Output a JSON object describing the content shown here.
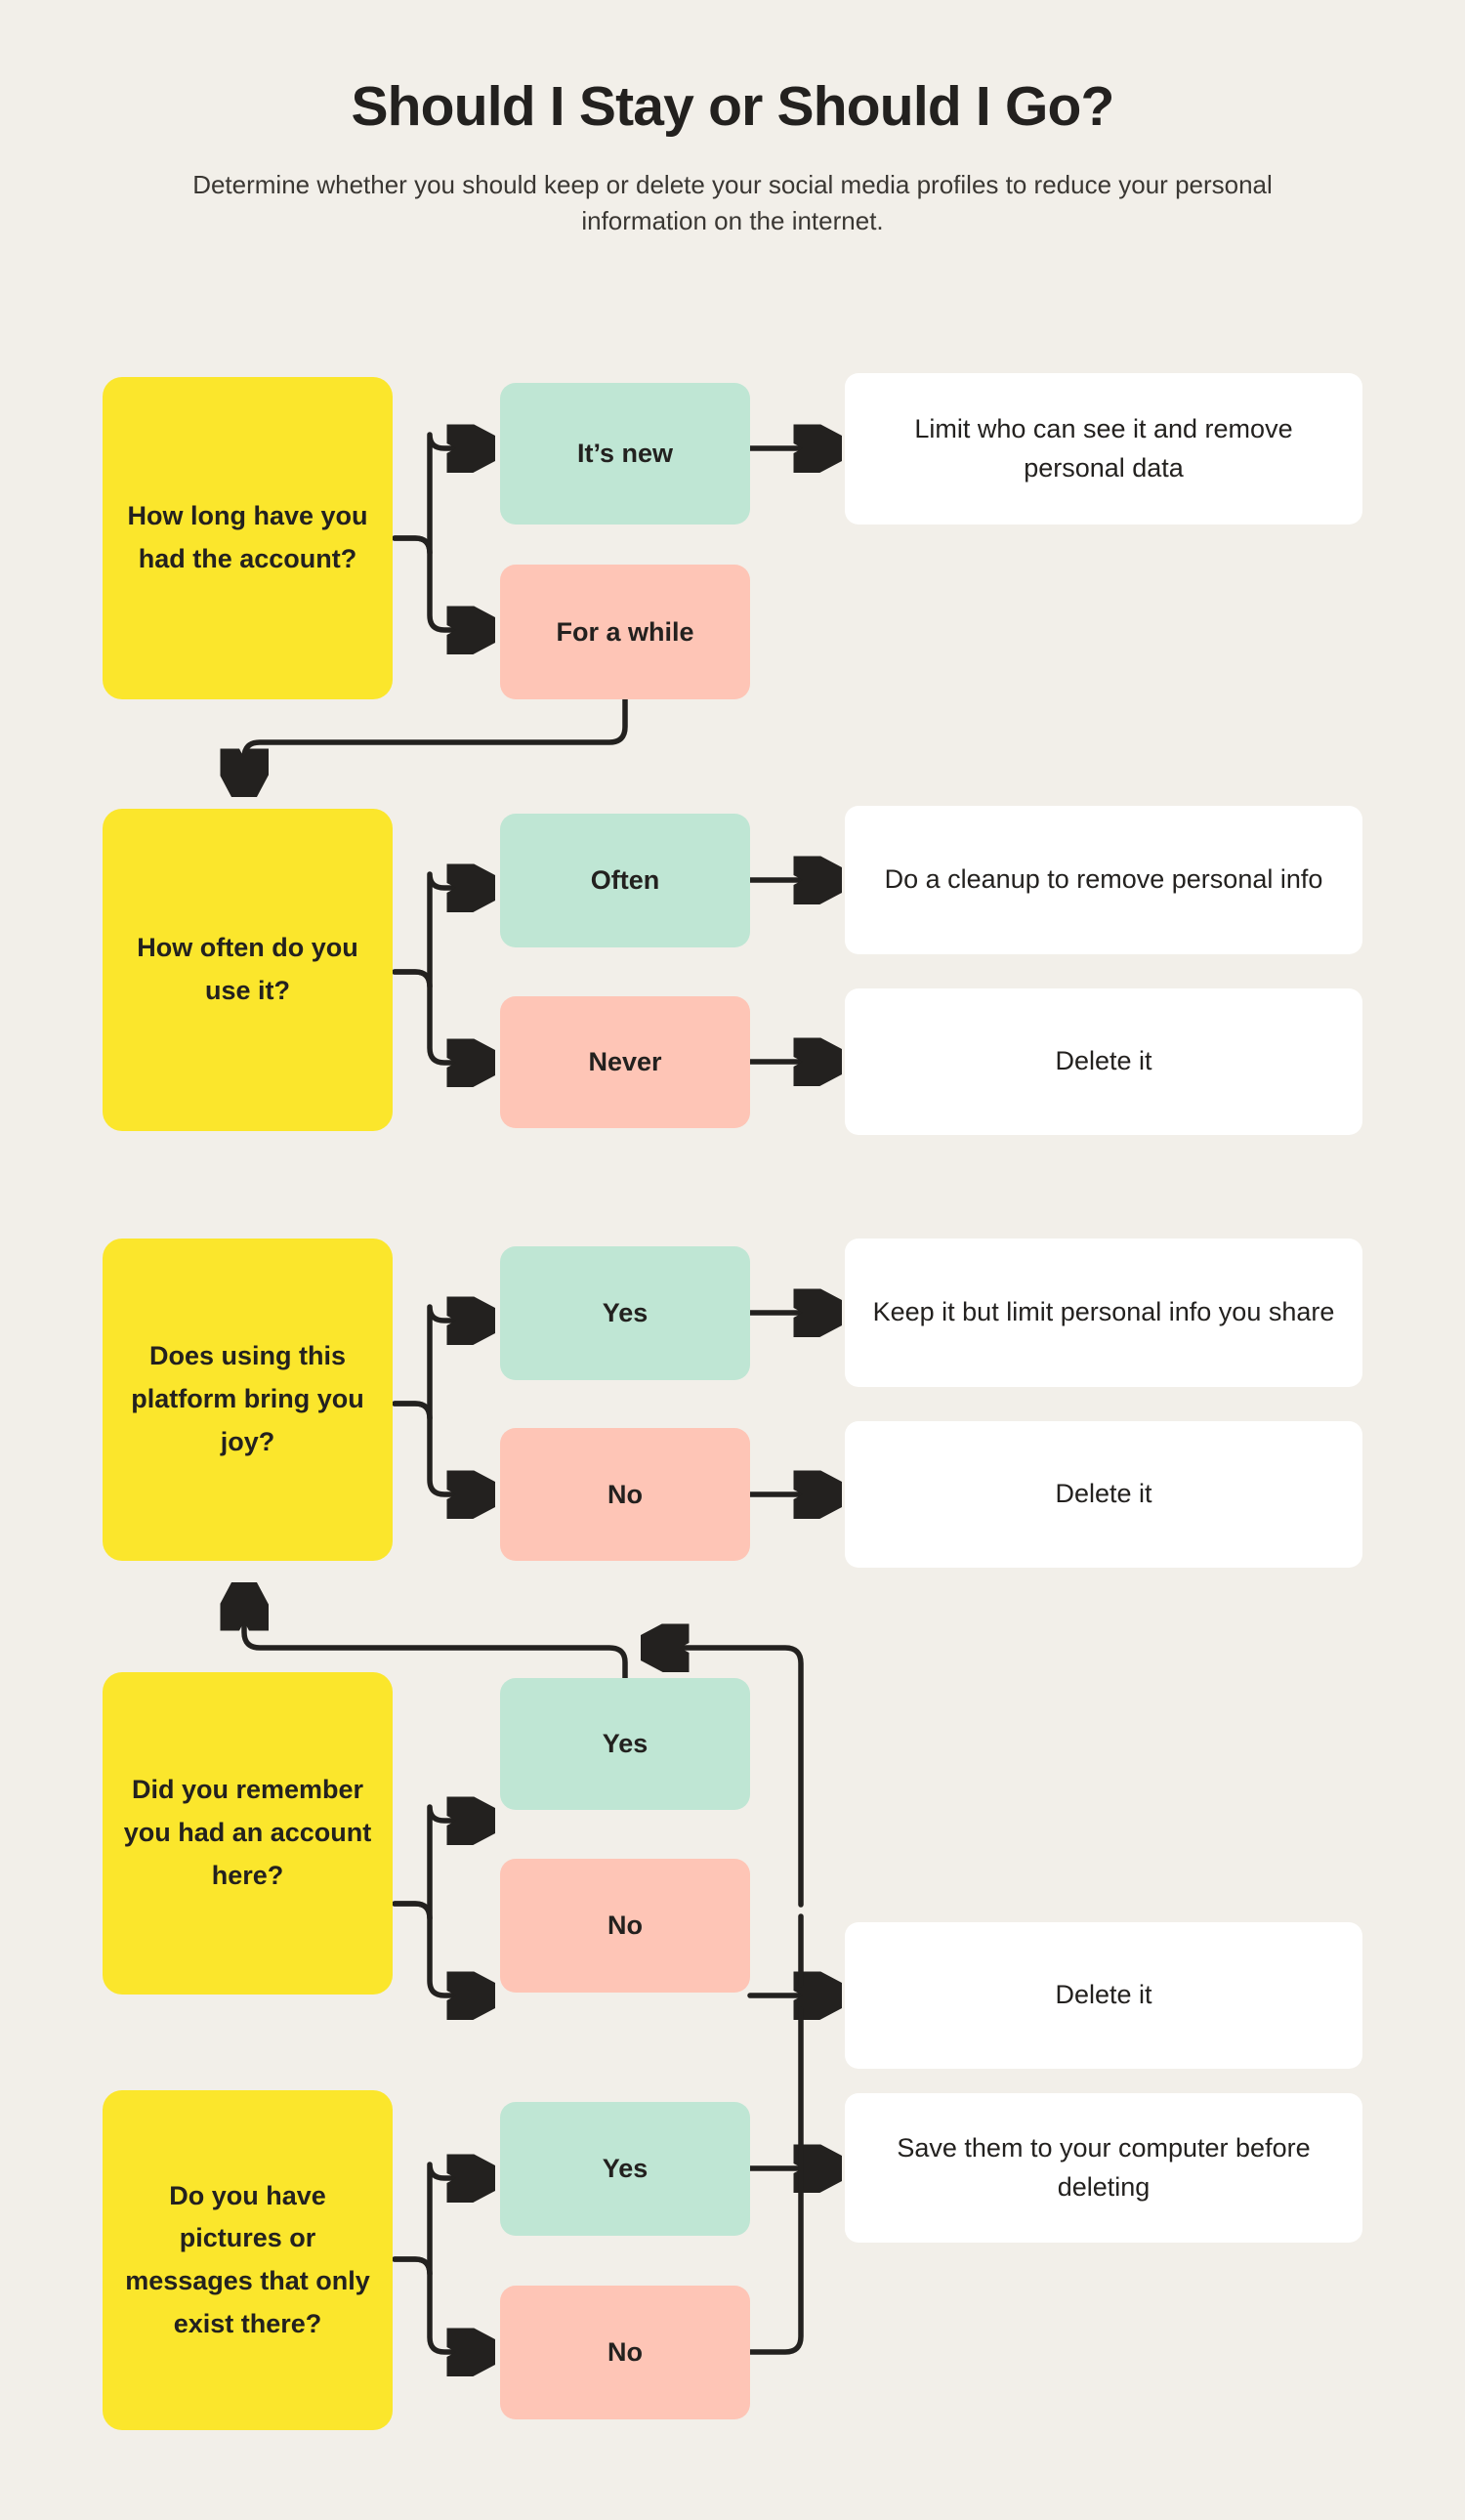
{
  "header": {
    "title": "Should I Stay or Should I Go?",
    "subtitle": "Determine whether you should keep or delete your social media profiles to reduce your personal information on the internet."
  },
  "colors": {
    "background": "#F2EFE9",
    "question": "#FBE62C",
    "answer_positive": "#BFE6D4",
    "answer_negative": "#FEC5B6",
    "outcome": "#FFFFFF",
    "ink": "#23211F"
  },
  "flow": {
    "steps": [
      {
        "question": "How long have you had the account?",
        "branches": [
          {
            "answer": "It’s new",
            "tone": "positive",
            "outcome": "Limit who can see it and remove personal data"
          },
          {
            "answer": "For a while",
            "tone": "negative",
            "outcome": null
          }
        ]
      },
      {
        "question": "How often do you use it?",
        "branches": [
          {
            "answer": "Often",
            "tone": "positive",
            "outcome": "Do a cleanup to remove personal info"
          },
          {
            "answer": "Never",
            "tone": "negative",
            "outcome": "Delete it"
          }
        ]
      },
      {
        "question": "Does using this platform bring you joy?",
        "branches": [
          {
            "answer": "Yes",
            "tone": "positive",
            "outcome": "Keep it but limit personal info you share"
          },
          {
            "answer": "No",
            "tone": "negative",
            "outcome": "Delete it"
          }
        ]
      },
      {
        "question": "Did you remember you had an account here?",
        "branches": [
          {
            "answer": "Yes",
            "tone": "positive",
            "outcome": null
          },
          {
            "answer": "No",
            "tone": "negative",
            "outcome": "Delete it"
          }
        ]
      },
      {
        "question": "Do you have pictures or messages that only exist there?",
        "branches": [
          {
            "answer": "Yes",
            "tone": "positive",
            "outcome": "Save them to your computer before deleting"
          },
          {
            "answer": "No",
            "tone": "negative",
            "outcome": null
          }
        ]
      }
    ]
  }
}
